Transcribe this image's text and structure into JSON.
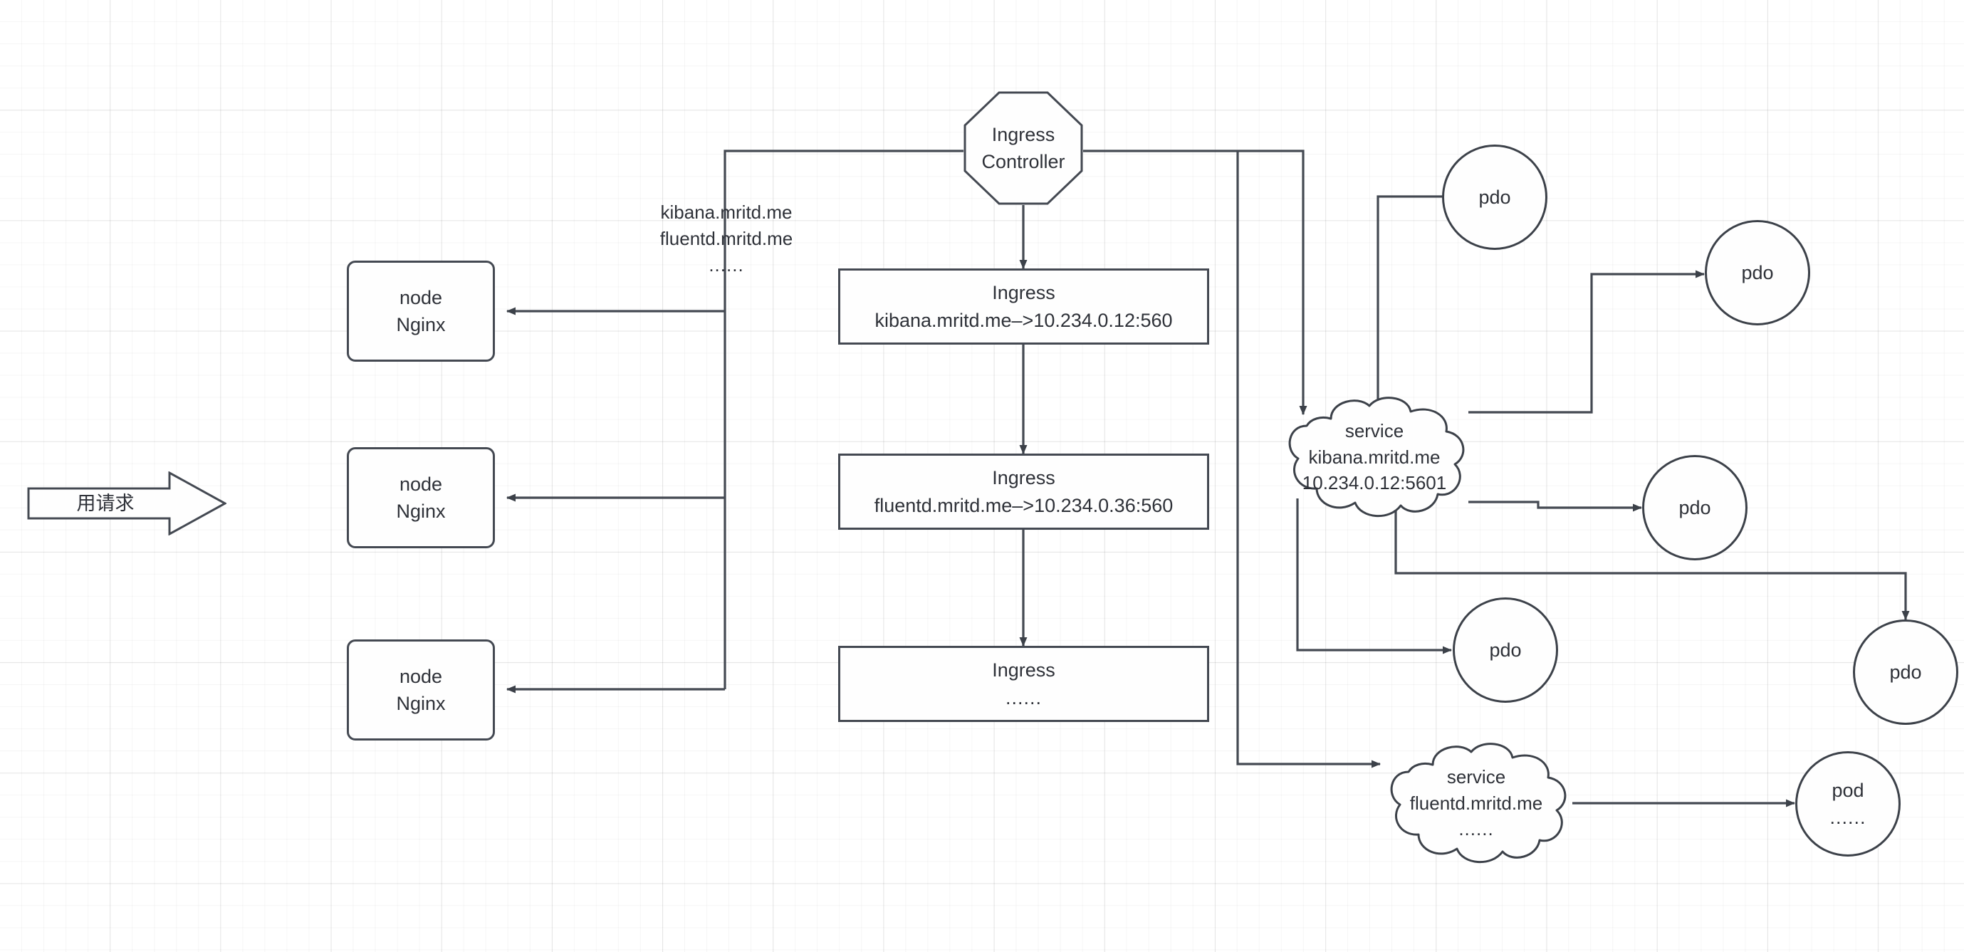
{
  "diagram": {
    "title": "Kubernetes Ingress request flow",
    "background": {
      "grid_minor_color": "#f2f2f2",
      "grid_major_color": "#ebebeb",
      "canvas_color": "#ffffff"
    },
    "stroke_color": "#444952",
    "text_color": "#2e3138"
  },
  "request_arrow": {
    "label": "用请求"
  },
  "nodes": [
    {
      "id": "node1",
      "line1": "node",
      "line2": "Nginx"
    },
    {
      "id": "node2",
      "line1": "node",
      "line2": "Nginx"
    },
    {
      "id": "node3",
      "line1": "node",
      "line2": "Nginx"
    }
  ],
  "host_list": {
    "line1": "kibana.mritd.me",
    "line2": "fluentd.mritd.me",
    "line3": "......"
  },
  "ingress_controller": {
    "line1": "Ingress",
    "line2": "Controller"
  },
  "ingress_rules": [
    {
      "id": "ingress-kibana",
      "line1": "Ingress",
      "line2": "kibana.mritd.me–>10.234.0.12:560"
    },
    {
      "id": "ingress-fluentd",
      "line1": "Ingress",
      "line2": "fluentd.mritd.me–>10.234.0.36:560"
    },
    {
      "id": "ingress-more",
      "line1": "Ingress",
      "line2": "......"
    }
  ],
  "services": [
    {
      "id": "service-kibana",
      "line1": "service",
      "line2": "kibana.mritd.me",
      "line3": "10.234.0.12:5601"
    },
    {
      "id": "service-fluentd",
      "line1": "service",
      "line2": "fluentd.mritd.me",
      "line3": "......"
    }
  ],
  "pods": [
    {
      "id": "pod-1",
      "line1": "pdo",
      "line2": ""
    },
    {
      "id": "pod-2",
      "line1": "pdo",
      "line2": ""
    },
    {
      "id": "pod-3",
      "line1": "pdo",
      "line2": ""
    },
    {
      "id": "pod-4",
      "line1": "pdo",
      "line2": ""
    },
    {
      "id": "pod-5",
      "line1": "pdo",
      "line2": ""
    },
    {
      "id": "pod-6",
      "line1": "pod",
      "line2": "......"
    }
  ]
}
